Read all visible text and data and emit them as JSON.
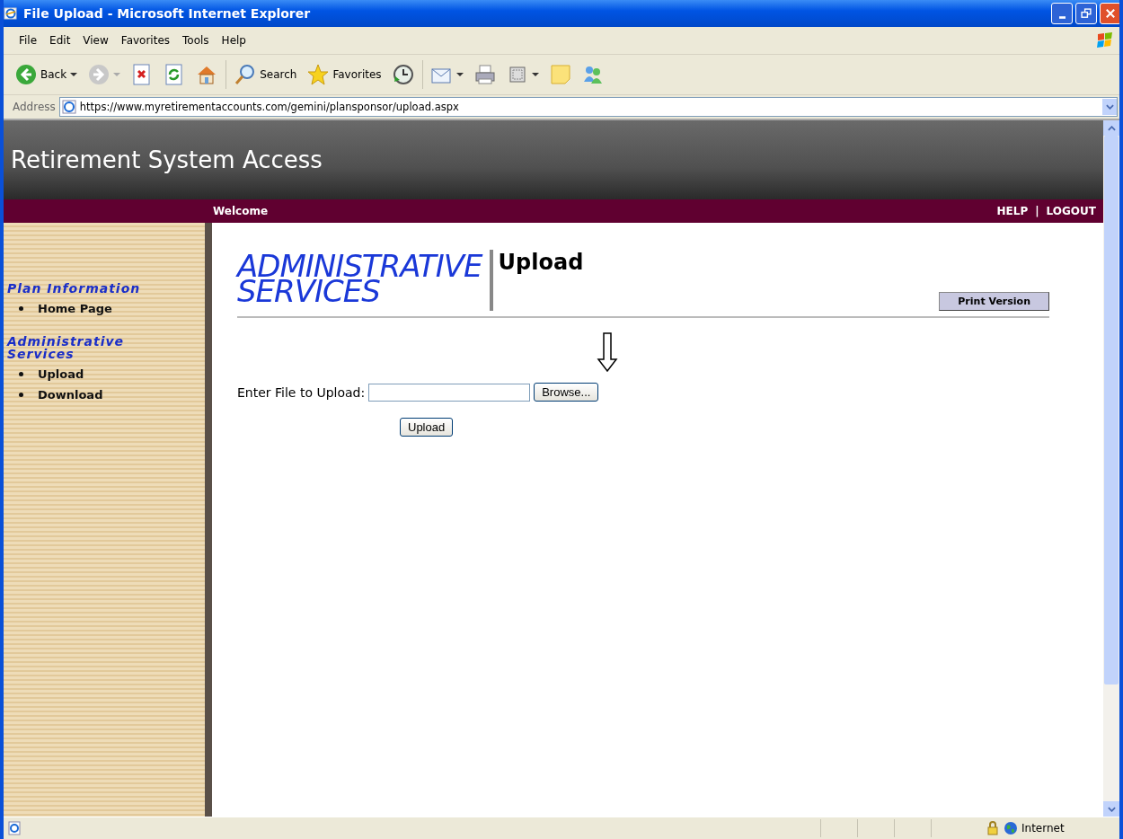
{
  "window": {
    "title": "File Upload - Microsoft Internet Explorer"
  },
  "menu": [
    "File",
    "Edit",
    "View",
    "Favorites",
    "Tools",
    "Help"
  ],
  "toolbar": [
    {
      "kind": "back",
      "label": "Back"
    },
    {
      "kind": "forward"
    },
    {
      "kind": "stop"
    },
    {
      "kind": "refresh"
    },
    {
      "kind": "home"
    },
    {
      "kind": "search",
      "label": "Search"
    },
    {
      "kind": "favorites",
      "label": "Favorites"
    },
    {
      "kind": "history"
    },
    {
      "kind": "mail"
    },
    {
      "kind": "print"
    },
    {
      "kind": "edit"
    },
    {
      "kind": "note"
    },
    {
      "kind": "messenger"
    }
  ],
  "address": {
    "label": "Address",
    "url": "https://www.myretirementaccounts.com/gemini/plansponsor/upload.aspx"
  },
  "page": {
    "site_title": "Retirement System Access",
    "nav": {
      "welcome": "Welcome",
      "links": [
        "HELP",
        "LOGOUT"
      ],
      "separator": "|"
    },
    "sidebar": [
      {
        "heading": "Plan Information",
        "items": [
          "Home Page"
        ]
      },
      {
        "heading": "Administrative Services",
        "items": [
          "Upload",
          "Download"
        ]
      }
    ],
    "brand": [
      "ADMINISTRATIVE",
      "SERVICES"
    ],
    "heading": "Upload",
    "print_button": "Print Version",
    "form": {
      "label": "Enter File to Upload:",
      "browse_button": "Browse...",
      "submit_button": "Upload"
    }
  },
  "status_bar": {
    "zone": "Internet"
  }
}
